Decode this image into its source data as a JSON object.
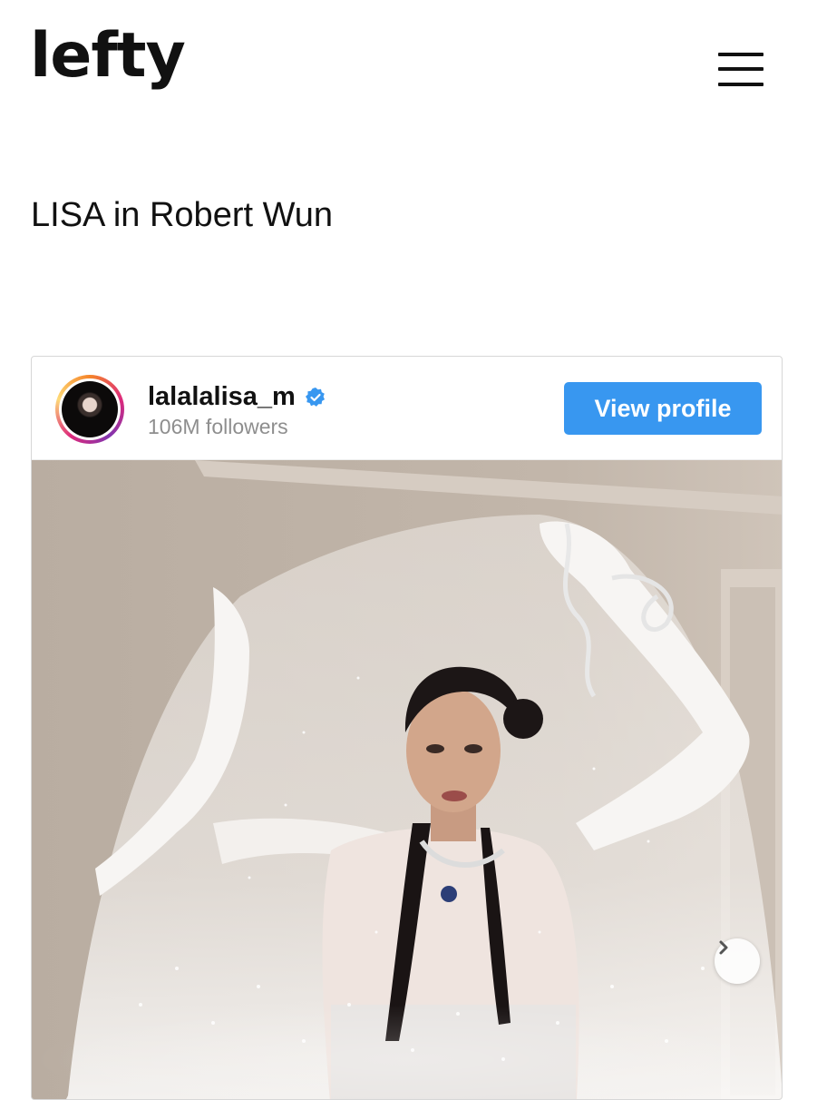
{
  "site": {
    "logo_text": "lefty"
  },
  "header": {
    "menu_icon": "hamburger-menu-icon"
  },
  "article": {
    "title": "LISA in Robert Wun"
  },
  "embed": {
    "username": "lalalalisa_m",
    "verified": true,
    "verified_icon": "verified-badge-icon",
    "followers": "106M followers",
    "view_profile_label": "View profile",
    "next_icon": "chevron-right-icon",
    "colors": {
      "button": "#3897f0",
      "verified": "#3897f0",
      "followers_text": "#8e8e8e"
    }
  }
}
